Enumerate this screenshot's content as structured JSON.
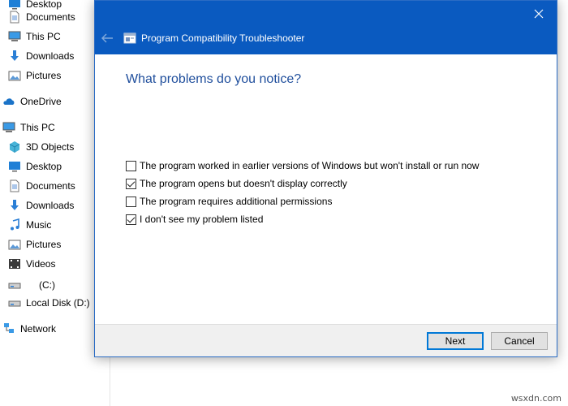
{
  "explorer": {
    "nav_items": [
      {
        "label": "Desktop",
        "icon": "desktop-icon",
        "indent": 1
      },
      {
        "label": "Documents",
        "icon": "documents-icon",
        "indent": 1
      },
      {
        "label": "This PC",
        "icon": "this-pc-icon",
        "indent": 1
      },
      {
        "label": "Downloads",
        "icon": "downloads-icon",
        "indent": 1
      },
      {
        "label": "Pictures",
        "icon": "pictures-icon",
        "indent": 1
      },
      {
        "label": "OneDrive",
        "icon": "onedrive-icon",
        "indent": 0
      },
      {
        "label": "This PC",
        "icon": "this-pc-icon",
        "indent": 0
      },
      {
        "label": "3D Objects",
        "icon": "3d-objects-icon",
        "indent": 1
      },
      {
        "label": "Desktop",
        "icon": "desktop-icon",
        "indent": 1
      },
      {
        "label": "Documents",
        "icon": "documents-icon",
        "indent": 1
      },
      {
        "label": "Downloads",
        "icon": "downloads-icon",
        "indent": 1
      },
      {
        "label": "Music",
        "icon": "music-icon",
        "indent": 1
      },
      {
        "label": "Pictures",
        "icon": "pictures-icon",
        "indent": 1
      },
      {
        "label": "Videos",
        "icon": "videos-icon",
        "indent": 1
      },
      {
        "label": "(C:)",
        "icon": "drive-icon",
        "indent": 1
      },
      {
        "label": "Local Disk (D:)",
        "icon": "drive-icon",
        "indent": 1
      },
      {
        "label": "Network",
        "icon": "network-icon",
        "indent": 0
      }
    ]
  },
  "dialog": {
    "title": "Program Compatibility Troubleshooter",
    "heading": "What problems do you notice?",
    "options": [
      {
        "label": "The program worked in earlier versions of Windows but won't install or run now",
        "checked": false
      },
      {
        "label": "The program opens but doesn't display correctly",
        "checked": true
      },
      {
        "label": "The program requires additional permissions",
        "checked": false
      },
      {
        "label": "I don't see my problem listed",
        "checked": true
      }
    ],
    "next_label": "Next",
    "cancel_label": "Cancel",
    "accent_color": "#0a5ac0"
  },
  "watermark": "wsxdn.com"
}
